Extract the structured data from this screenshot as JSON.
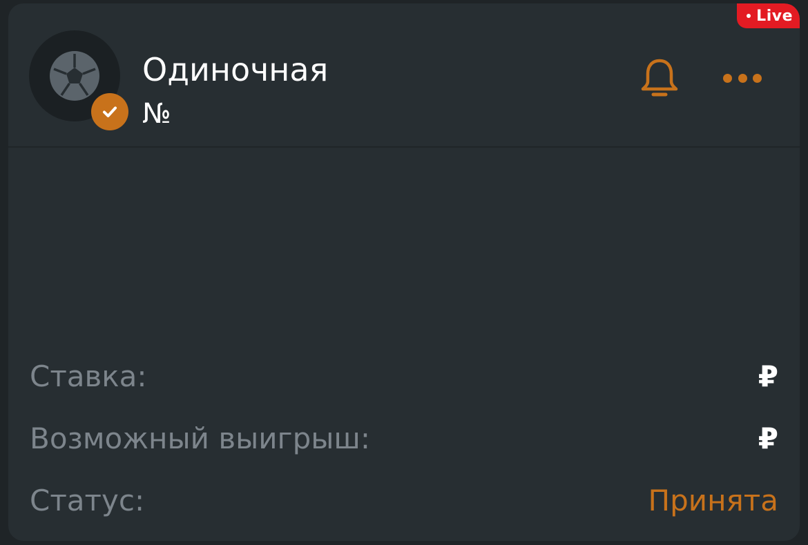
{
  "badge": {
    "live_label": "Live"
  },
  "header": {
    "title": "Одиночная",
    "subtitle": "№"
  },
  "icons": {
    "avatar": "soccer-ball-icon",
    "verified": "check-icon",
    "notifications": "bell-icon",
    "menu": "more-dots-icon"
  },
  "details": {
    "stake": {
      "label": "Ставка:",
      "value": "₽"
    },
    "possible_win": {
      "label": "Возможный выигрыш:",
      "value": "₽"
    },
    "status": {
      "label": "Статус:",
      "value": "Принята"
    }
  },
  "colors": {
    "accent": "#c8721b",
    "live": "#e31b23",
    "card_bg": "#272e32",
    "muted_text": "#7d858c"
  }
}
